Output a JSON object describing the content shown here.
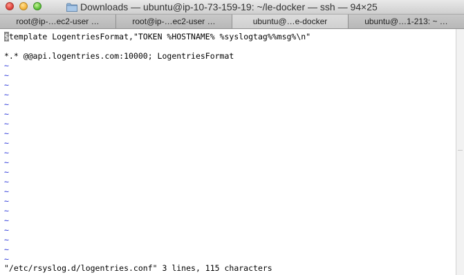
{
  "window": {
    "title": "Downloads — ubuntu@ip-10-73-159-19: ~/le-docker — ssh — 94×25",
    "icon": "folder-icon"
  },
  "tabs": [
    {
      "label": "root@ip-…ec2-user …",
      "active": false
    },
    {
      "label": "root@ip-…ec2-user …",
      "active": false
    },
    {
      "label": "ubuntu@…e-docker",
      "active": true
    },
    {
      "label": "ubuntu@…1-213: ~ …",
      "active": false
    }
  ],
  "terminal": {
    "lines": [
      {
        "cursor_char": "$",
        "text": "template LogentriesFormat,\"TOKEN %HOSTNAME% %syslogtag%%msg%\\n\""
      },
      {
        "text": ""
      },
      {
        "text": "*.* @@api.logentries.com:10000; LogentriesFormat"
      }
    ],
    "empty_line_marker": "~",
    "empty_line_count": 21,
    "status_line": "\"/etc/rsyslog.d/logentries.conf\" 3 lines, 115 characters"
  },
  "colors": {
    "tilde": "#2a36d8",
    "cursor": "#8a8a8a"
  }
}
